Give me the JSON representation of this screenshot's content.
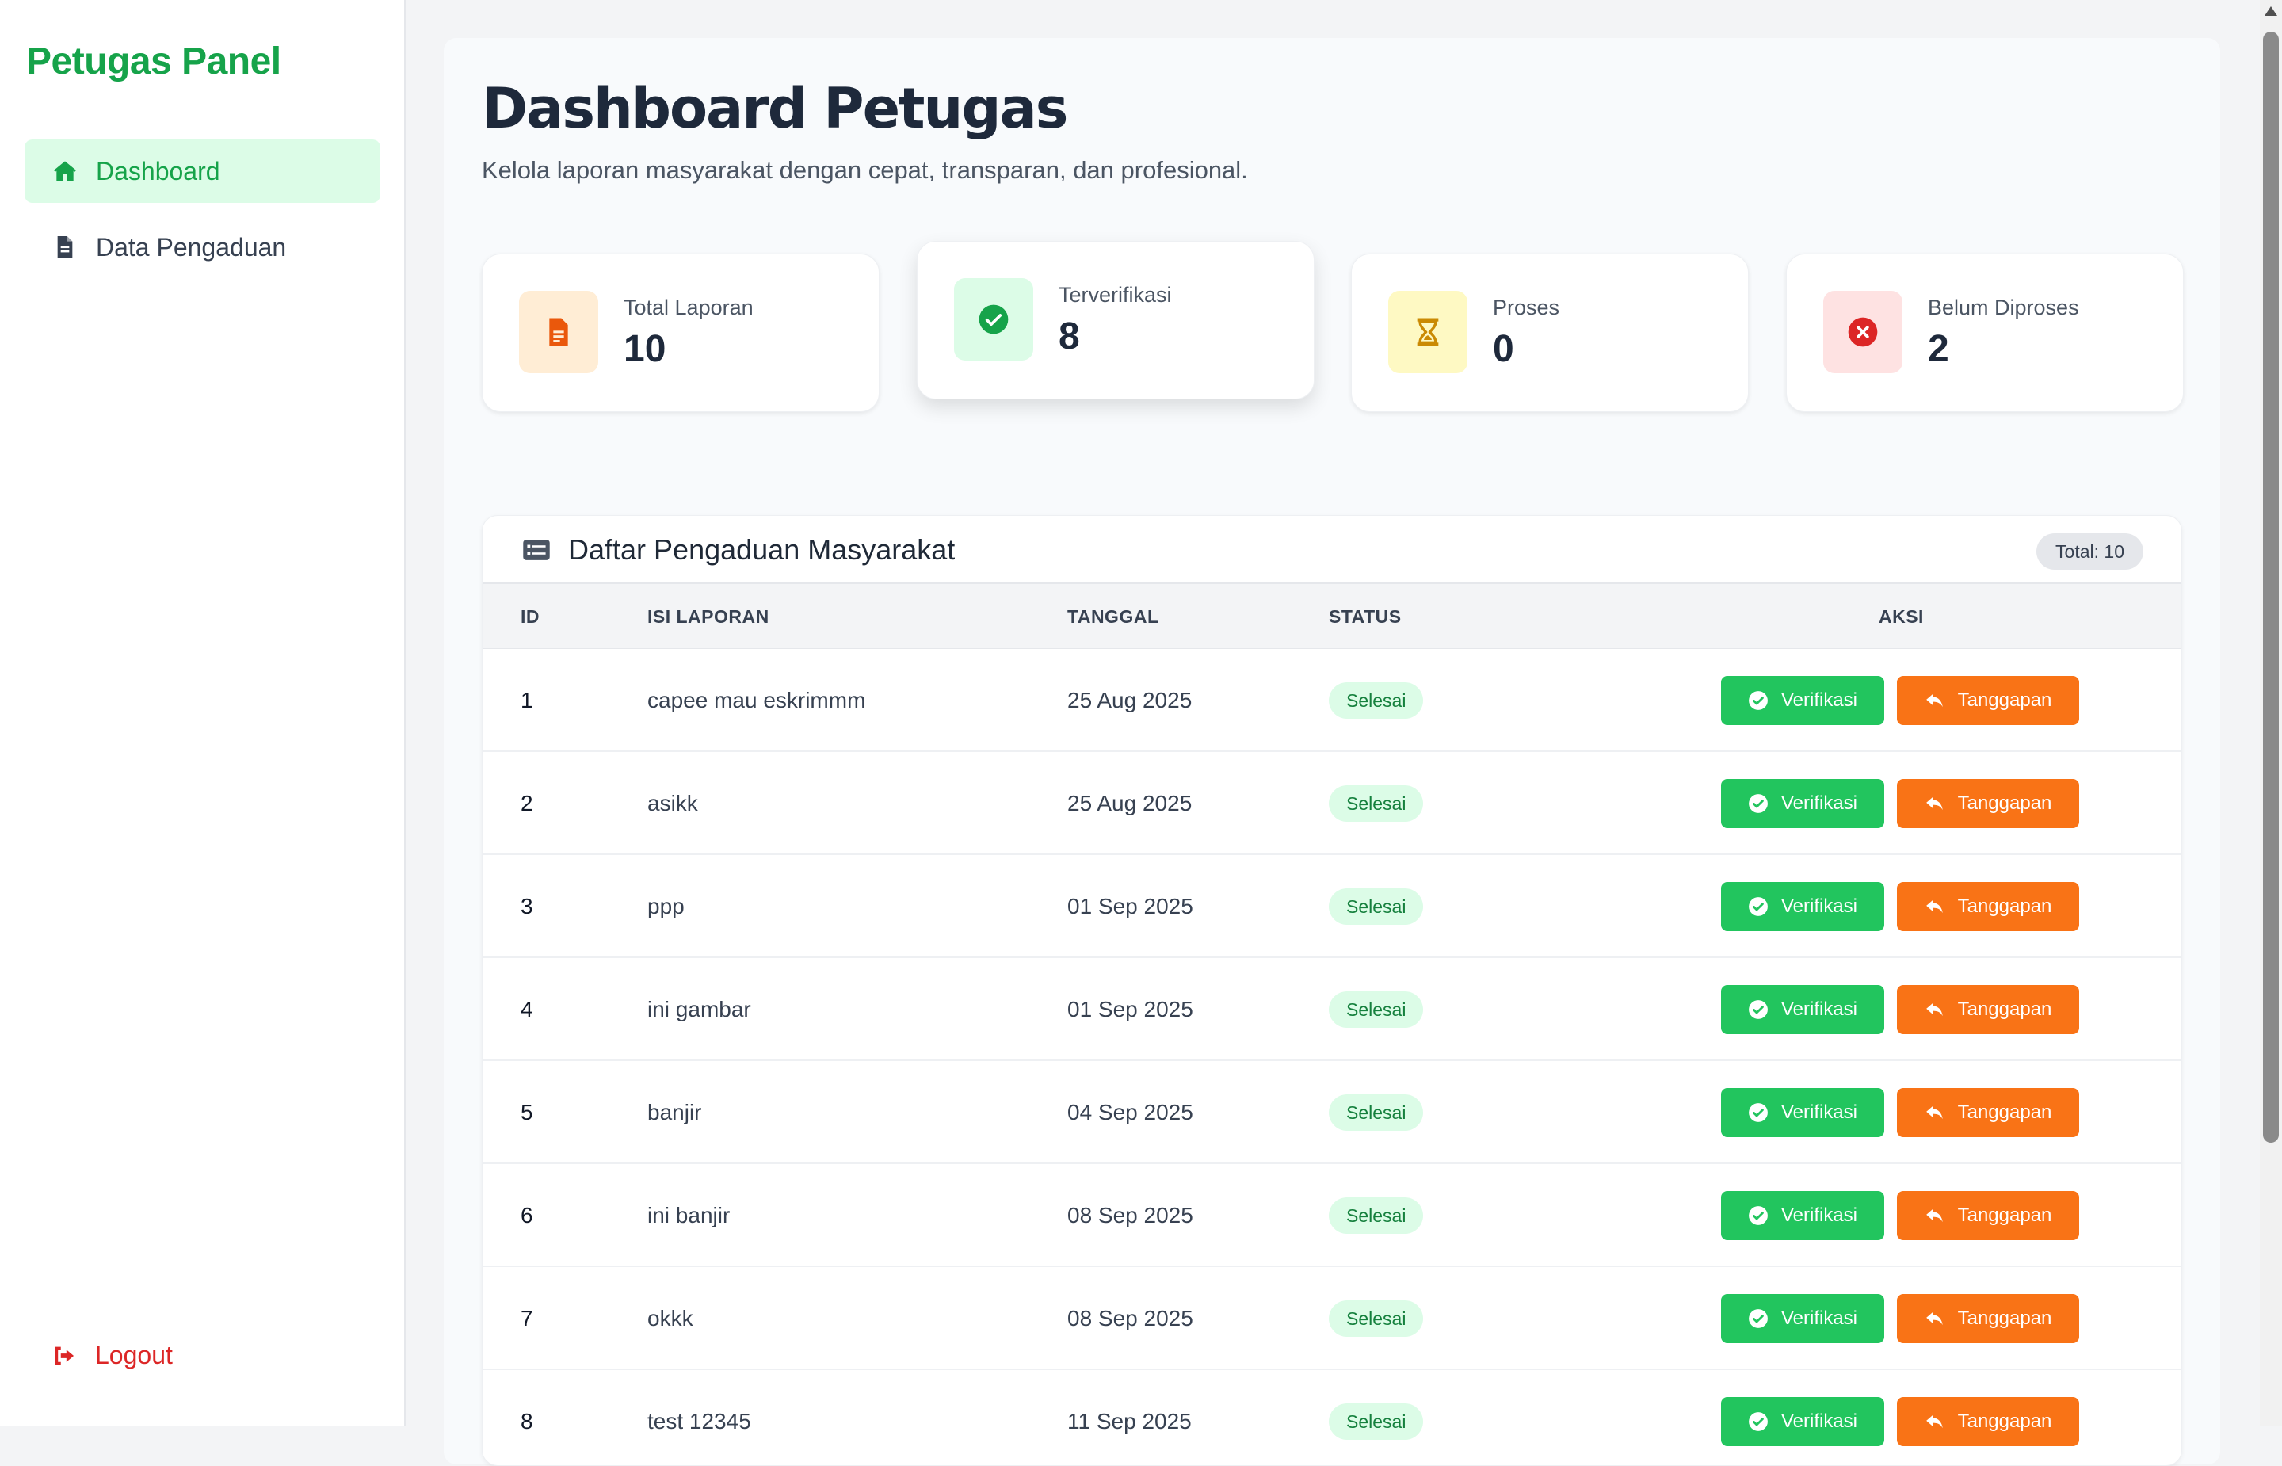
{
  "sidebar": {
    "brand": "Petugas Panel",
    "items": [
      {
        "label": "Dashboard",
        "icon": "home-icon",
        "active": true
      },
      {
        "label": "Data Pengaduan",
        "icon": "document-icon",
        "active": false
      }
    ],
    "logout_label": "Logout"
  },
  "header": {
    "title": "Dashboard Petugas",
    "subtitle": "Kelola laporan masyarakat dengan cepat, transparan, dan profesional."
  },
  "stats": [
    {
      "label": "Total Laporan",
      "value": "10",
      "icon": "document-icon",
      "color": "#ea580c",
      "bg": "#ffedd5"
    },
    {
      "label": "Terverifikasi",
      "value": "8",
      "icon": "check-circle-icon",
      "color": "#16a34a",
      "bg": "#dcfce7"
    },
    {
      "label": "Proses",
      "value": "0",
      "icon": "hourglass-icon",
      "color": "#ca8a04",
      "bg": "#fef9c3"
    },
    {
      "label": "Belum Diproses",
      "value": "2",
      "icon": "x-circle-icon",
      "color": "#dc2626",
      "bg": "#fee2e2"
    }
  ],
  "table": {
    "title": "Daftar Pengaduan Masyarakat",
    "total_label": "Total: 10",
    "columns": [
      "ID",
      "ISI LAPORAN",
      "TANGGAL",
      "STATUS",
      "AKSI"
    ],
    "verify_label": "Verifikasi",
    "respond_label": "Tanggapan",
    "rows": [
      {
        "id": "1",
        "isi": "capee mau eskrimmm",
        "tanggal": "25 Aug 2025",
        "status": "Selesai"
      },
      {
        "id": "2",
        "isi": "asikk",
        "tanggal": "25 Aug 2025",
        "status": "Selesai"
      },
      {
        "id": "3",
        "isi": "ppp",
        "tanggal": "01 Sep 2025",
        "status": "Selesai"
      },
      {
        "id": "4",
        "isi": "ini gambar",
        "tanggal": "01 Sep 2025",
        "status": "Selesai"
      },
      {
        "id": "5",
        "isi": "banjir",
        "tanggal": "04 Sep 2025",
        "status": "Selesai"
      },
      {
        "id": "6",
        "isi": "ini banjir",
        "tanggal": "08 Sep 2025",
        "status": "Selesai"
      },
      {
        "id": "7",
        "isi": "okkk",
        "tanggal": "08 Sep 2025",
        "status": "Selesai"
      },
      {
        "id": "8",
        "isi": "test 12345",
        "tanggal": "11 Sep 2025",
        "status": "Selesai"
      }
    ]
  },
  "colors": {
    "brand": "#16a34a",
    "verify": "#22c55e",
    "respond": "#f97316",
    "danger": "#dc2626"
  }
}
